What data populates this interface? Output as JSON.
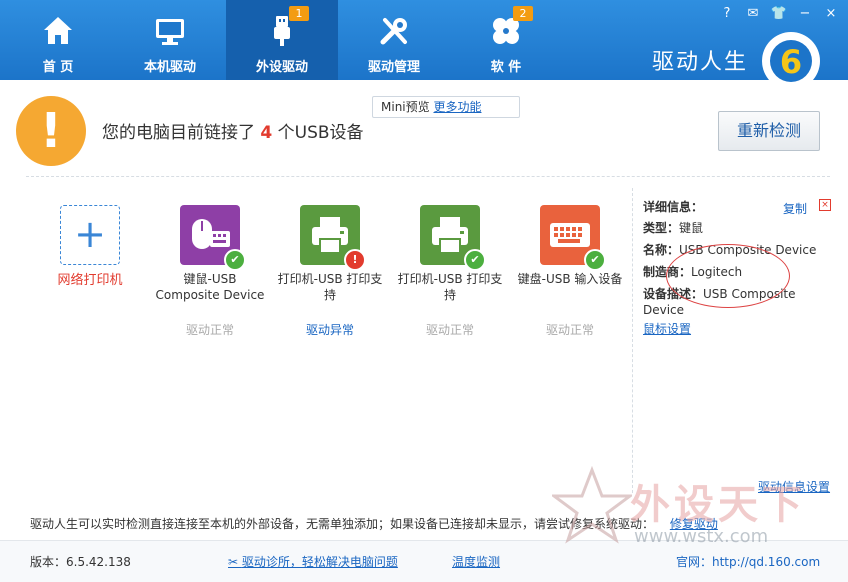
{
  "nav": {
    "items": [
      {
        "label": "首 页",
        "icon": "home-icon"
      },
      {
        "label": "本机驱动",
        "icon": "monitor-icon"
      },
      {
        "label": "外设驱动",
        "icon": "usb-icon",
        "badge": "1",
        "active": true
      },
      {
        "label": "驱动管理",
        "icon": "tools-icon"
      },
      {
        "label": "软 件",
        "icon": "apps-icon",
        "badge": "2"
      }
    ],
    "brand": "驱动人生",
    "logo_text": "6"
  },
  "window_buttons": [
    "?",
    "✉",
    "👕",
    "−",
    "×"
  ],
  "header": {
    "status_prefix": "您的电脑目前链接了",
    "count": "4",
    "status_suffix": "个USB设备",
    "mini_label": "Mini预览",
    "mini_link": "更多功能",
    "rescan_label": "重新检测"
  },
  "devices": [
    {
      "name": "网络打印机",
      "state": "",
      "type": "add"
    },
    {
      "name": "键鼠-USB Composite Device",
      "state": "驱动正常",
      "color": "#8e3fa6",
      "icon": "mouse-keyboard-icon",
      "mark": "ok"
    },
    {
      "name": "打印机-USB 打印支持",
      "state": "驱动异常",
      "color": "#5a9a3f",
      "icon": "printer-icon",
      "mark": "bad"
    },
    {
      "name": "打印机-USB 打印支持",
      "state": "驱动正常",
      "color": "#5a9a3f",
      "icon": "printer-icon",
      "mark": "ok"
    },
    {
      "name": "键盘-USB 输入设备",
      "state": "驱动正常",
      "color": "#e9623d",
      "icon": "keyboard-icon",
      "mark": "ok"
    }
  ],
  "details": {
    "title": "详细信息：",
    "copy": "复制",
    "type_label": "类型：",
    "type_value": "键鼠",
    "name_label": "名称：",
    "name_value": "USB Composite Device",
    "maker_label": "制造商：",
    "maker_value": "Logitech",
    "desc_label": "设备描述：",
    "desc_value": "USB Composite Device",
    "mouse_settings": "鼠标设置",
    "detail_settings": "驱动信息设置"
  },
  "hint": {
    "text": "驱动人生可以实时检测直接连接至本机的外部设备，无需单独添加；如果设备已连接却未显示，请尝试修复系统驱动：",
    "link": "修复驱动"
  },
  "footer": {
    "version": "版本：6.5.42.138",
    "diagnose": "驱动诊所，轻松解决电脑问题",
    "temp": "温度监测",
    "site": "官网：http://qd.160.com"
  },
  "watermark": {
    "cn": "外设天下",
    "url": "www.wstx.com"
  }
}
